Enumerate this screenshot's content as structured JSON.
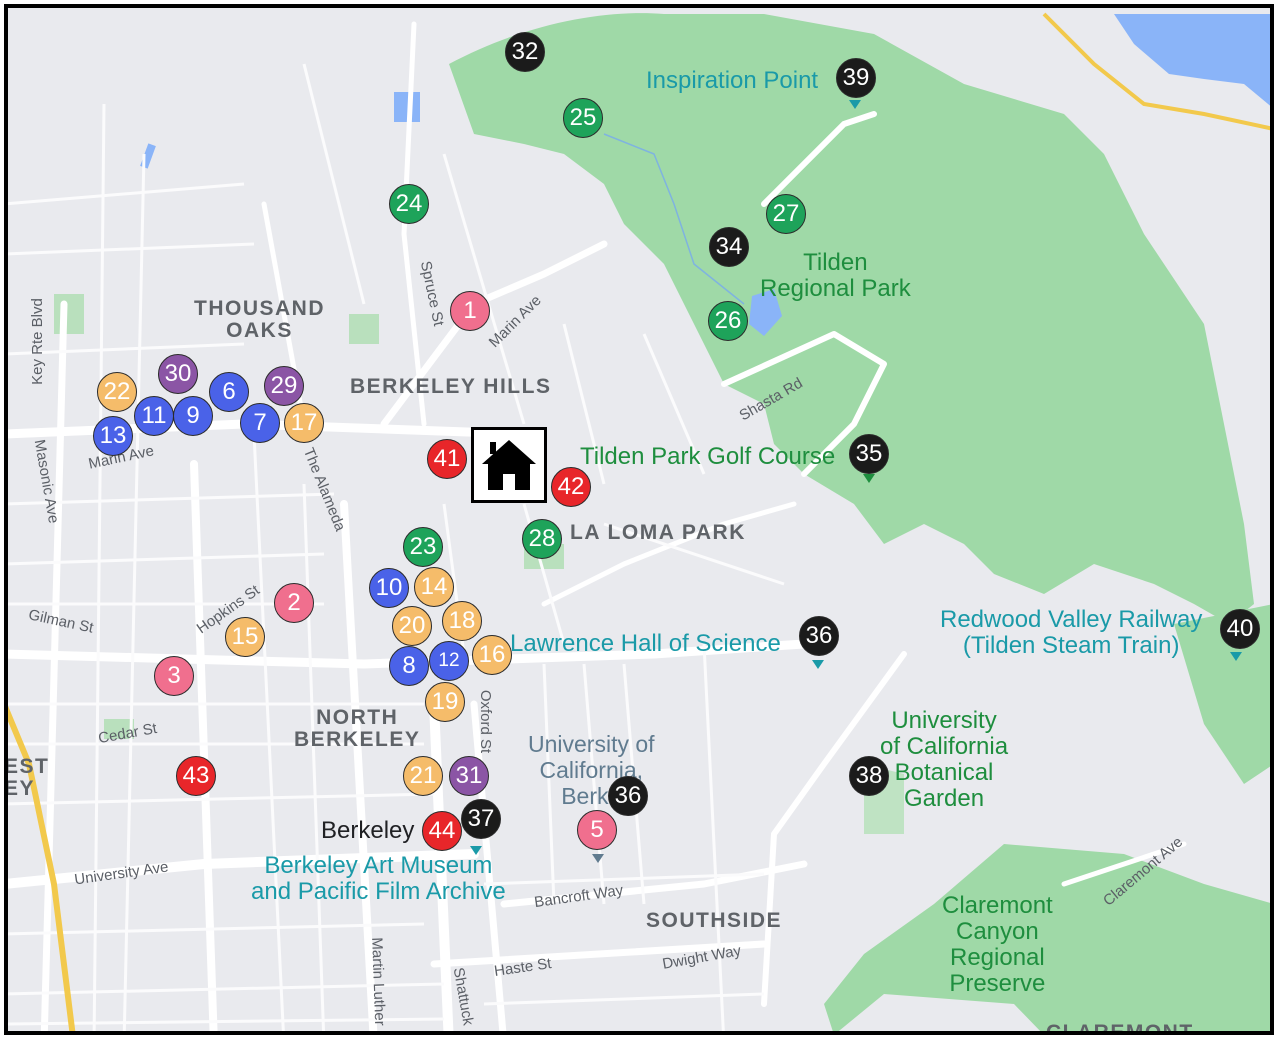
{
  "colors": {
    "pink": "#f06f8e",
    "orange": "#f5bc6a",
    "blue": "#4a62e8",
    "purple": "#8b55a5",
    "green": "#1ea35a",
    "black": "#1b1b1b",
    "red": "#e8262a",
    "park_fill": "#9fd9a7",
    "road_fill": "#ffffff",
    "highway": "#f2c94c"
  },
  "area_labels": {
    "thousand_oaks": "THOUSAND\nOAKS",
    "berkeley_hills": "BERKELEY HILLS",
    "la_loma_park": "LA LOMA PARK",
    "north_berkeley": "NORTH\nBERKELEY",
    "southside": "SOUTHSIDE",
    "claremont": "CLAREMONT",
    "west_berkeley_partial": "EST\nEY"
  },
  "street_labels": {
    "spruce": "Spruce St",
    "marin_ave_hills": "Marin Ave",
    "marin_ave_west": "Marin Ave",
    "shasta": "Shasta Rd",
    "key_route": "Key Rte Blvd",
    "masonic": "Masonic Ave",
    "the_alameda": "The Alameda",
    "hopkins": "Hopkins St",
    "gilman": "Gilman St",
    "cedar": "Cedar St",
    "oxford": "Oxford St",
    "university": "University Ave",
    "bancroft": "Bancroft Way",
    "haste": "Haste St",
    "dwight": "Dwight Way",
    "martin_luther": "Martin Luther",
    "shattuck": "Shattuck",
    "claremont_ave": "Claremont Ave"
  },
  "places": {
    "inspiration_point": "Inspiration Point",
    "tilden_park": "Tilden\nRegional Park",
    "tilden_golf": "Tilden Park Golf Course",
    "lawrence": "Lawrence Hall of Science",
    "redwood_valley": "Redwood Valley Railway\n(Tilden Steam Train)",
    "botanical_garden": "University\nof California\nBotanical\nGarden",
    "uc_berkeley": "University of\nCalifornia,\nBerke",
    "berkeley_city": "Berkeley",
    "art_museum": "Berkeley Art Museum\nand Pacific Film Archive",
    "claremont_canyon": "Claremont\nCanyon\nRegional\nPreserve"
  },
  "markers": [
    {
      "label": "1",
      "color": "pink"
    },
    {
      "label": "2",
      "color": "pink"
    },
    {
      "label": "3",
      "color": "pink"
    },
    {
      "label": "5",
      "color": "pink"
    },
    {
      "label": "6",
      "color": "blue"
    },
    {
      "label": "7",
      "color": "blue"
    },
    {
      "label": "8",
      "color": "blue"
    },
    {
      "label": "9",
      "color": "blue"
    },
    {
      "label": "10",
      "color": "blue"
    },
    {
      "label": "11",
      "color": "blue"
    },
    {
      "label": "12",
      "color": "blue"
    },
    {
      "label": "13",
      "color": "blue"
    },
    {
      "label": "14",
      "color": "orange"
    },
    {
      "label": "15",
      "color": "orange"
    },
    {
      "label": "16",
      "color": "orange"
    },
    {
      "label": "17",
      "color": "orange"
    },
    {
      "label": "18",
      "color": "orange"
    },
    {
      "label": "19",
      "color": "orange"
    },
    {
      "label": "20",
      "color": "orange"
    },
    {
      "label": "21",
      "color": "orange"
    },
    {
      "label": "22",
      "color": "orange"
    },
    {
      "label": "23",
      "color": "green"
    },
    {
      "label": "24",
      "color": "green"
    },
    {
      "label": "25",
      "color": "green"
    },
    {
      "label": "26",
      "color": "green"
    },
    {
      "label": "27",
      "color": "green"
    },
    {
      "label": "28",
      "color": "green"
    },
    {
      "label": "29",
      "color": "purple"
    },
    {
      "label": "30",
      "color": "purple"
    },
    {
      "label": "31",
      "color": "purple"
    },
    {
      "label": "32",
      "color": "black"
    },
    {
      "label": "34",
      "color": "black"
    },
    {
      "label": "35",
      "color": "black"
    },
    {
      "label": "36",
      "color": "black"
    },
    {
      "label": "36",
      "color": "black"
    },
    {
      "label": "37",
      "color": "black"
    },
    {
      "label": "38",
      "color": "black"
    },
    {
      "label": "39",
      "color": "black"
    },
    {
      "label": "40",
      "color": "black"
    },
    {
      "label": "41",
      "color": "red"
    },
    {
      "label": "42",
      "color": "red"
    },
    {
      "label": "43",
      "color": "red"
    },
    {
      "label": "44",
      "color": "red"
    }
  ],
  "home_icon": "house-icon"
}
